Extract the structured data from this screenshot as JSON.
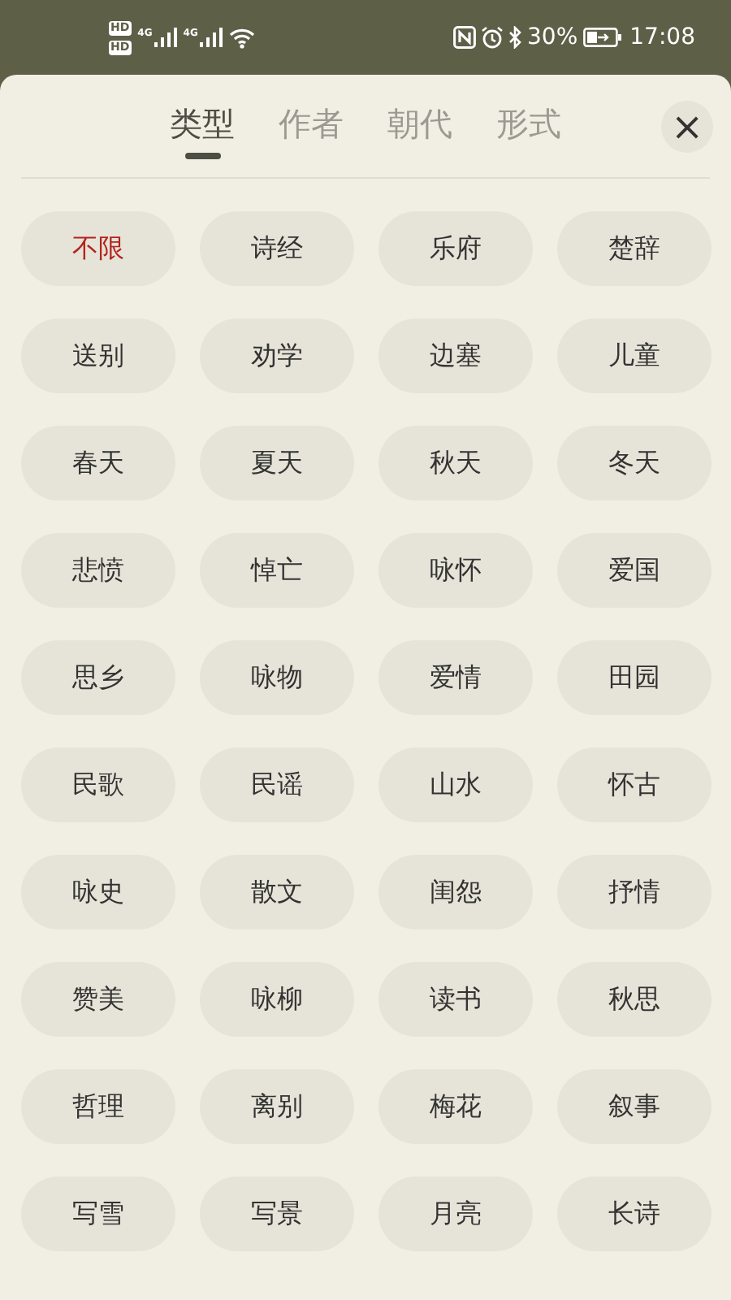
{
  "status_bar": {
    "sim_badges": [
      "HD",
      "HD"
    ],
    "networks": [
      "4G",
      "4G"
    ],
    "battery": "30%",
    "time": "17:08"
  },
  "tabs": [
    {
      "label": "类型",
      "selected": true
    },
    {
      "label": "作者",
      "selected": false
    },
    {
      "label": "朝代",
      "selected": false
    },
    {
      "label": "形式",
      "selected": false
    }
  ],
  "close_button": "×",
  "options": [
    {
      "label": "不限",
      "selected": true
    },
    {
      "label": "诗经",
      "selected": false
    },
    {
      "label": "乐府",
      "selected": false
    },
    {
      "label": "楚辞",
      "selected": false
    },
    {
      "label": "送别",
      "selected": false
    },
    {
      "label": "劝学",
      "selected": false
    },
    {
      "label": "边塞",
      "selected": false
    },
    {
      "label": "儿童",
      "selected": false
    },
    {
      "label": "春天",
      "selected": false
    },
    {
      "label": "夏天",
      "selected": false
    },
    {
      "label": "秋天",
      "selected": false
    },
    {
      "label": "冬天",
      "selected": false
    },
    {
      "label": "悲愤",
      "selected": false
    },
    {
      "label": "悼亡",
      "selected": false
    },
    {
      "label": "咏怀",
      "selected": false
    },
    {
      "label": "爱国",
      "selected": false
    },
    {
      "label": "思乡",
      "selected": false
    },
    {
      "label": "咏物",
      "selected": false
    },
    {
      "label": "爱情",
      "selected": false
    },
    {
      "label": "田园",
      "selected": false
    },
    {
      "label": "民歌",
      "selected": false
    },
    {
      "label": "民谣",
      "selected": false
    },
    {
      "label": "山水",
      "selected": false
    },
    {
      "label": "怀古",
      "selected": false
    },
    {
      "label": "咏史",
      "selected": false
    },
    {
      "label": "散文",
      "selected": false
    },
    {
      "label": "闺怨",
      "selected": false
    },
    {
      "label": "抒情",
      "selected": false
    },
    {
      "label": "赞美",
      "selected": false
    },
    {
      "label": "咏柳",
      "selected": false
    },
    {
      "label": "读书",
      "selected": false
    },
    {
      "label": "秋思",
      "selected": false
    },
    {
      "label": "哲理",
      "selected": false
    },
    {
      "label": "离别",
      "selected": false
    },
    {
      "label": "梅花",
      "selected": false
    },
    {
      "label": "叙事",
      "selected": false
    },
    {
      "label": "写雪",
      "selected": false
    },
    {
      "label": "写景",
      "selected": false
    },
    {
      "label": "月亮",
      "selected": false
    },
    {
      "label": "长诗",
      "selected": false
    }
  ]
}
